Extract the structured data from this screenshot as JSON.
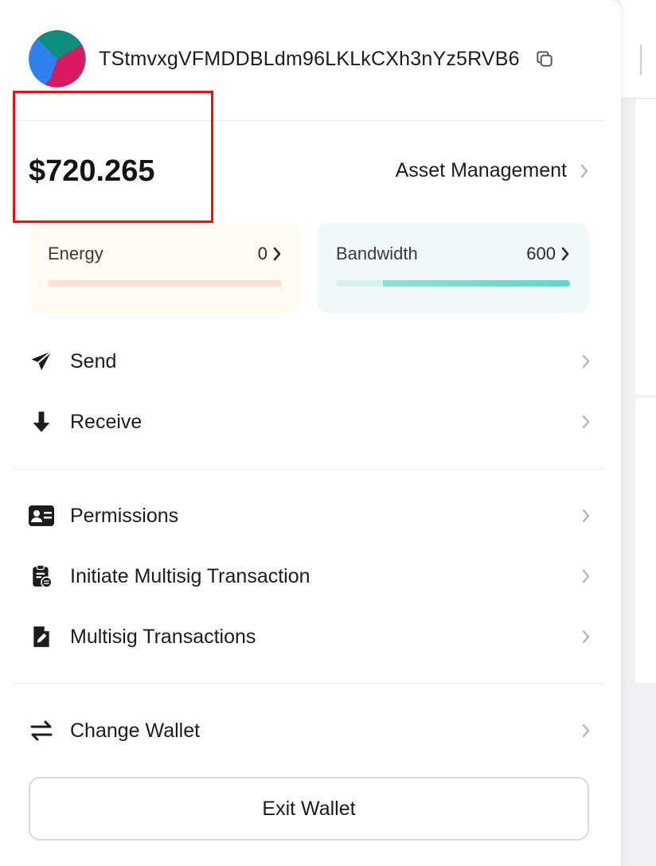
{
  "account": {
    "address": "TStmvxgVFMDDBLdm96LKLkCXh3nYz5RVB6",
    "avatar_colors": [
      "#2f80ed",
      "#0e8f7e",
      "#d81b60"
    ]
  },
  "balance": {
    "value": "$720.265"
  },
  "asset_management": {
    "label": "Asset Management"
  },
  "resources": {
    "energy": {
      "label": "Energy",
      "value": "0",
      "fill": 0
    },
    "bandwidth": {
      "label": "Bandwidth",
      "value": "600",
      "fill": 1
    }
  },
  "menu": {
    "send": "Send",
    "receive": "Receive",
    "permissions": "Permissions",
    "initiate_multisig": "Initiate Multisig Transaction",
    "multisig_transactions": "Multisig Transactions",
    "change_wallet": "Change Wallet"
  },
  "exit_button": "Exit Wallet",
  "colors": {
    "highlight_box": "#e8110f",
    "energy_bg": "#fffaf2",
    "bandwidth_bar": "#5fd6c6"
  }
}
